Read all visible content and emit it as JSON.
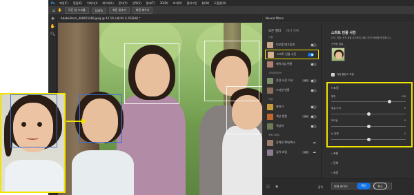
{
  "menubar": {
    "items": [
      "파일(F)",
      "편집(E)",
      "이미지(I)",
      "레이어(L)",
      "문자(Y)",
      "선택(S)",
      "필터(T)",
      "3D(D)",
      "보기(V)",
      "플러그인",
      "창(W)",
      "도움말(H)"
    ]
  },
  "share_label": "공유",
  "options": {
    "items": [
      "모든 창 스크롤",
      "100%",
      "화면 맞추기",
      "화면 채우기"
    ]
  },
  "document": {
    "tab_title": "AdobeStock_468625489.jpeg @ 42.5% (레이어 0, RGB/8) *"
  },
  "neural": {
    "panel_title": "Neural filters",
    "tab_all": "모든 필터",
    "tab_waitlist": "대기 목록",
    "cat_portrait": "인물",
    "cat_creative": "크리에이티브",
    "cat_color": "색상",
    "cat_photo": "포토그래피",
    "filters": [
      {
        "name": "피부를 매끄럽게",
        "state": "off"
      },
      {
        "name": "스마트 인물 사진",
        "state": "on"
      },
      {
        "name": "메이크업 변환",
        "state": "off"
      },
      {
        "name": "풍경 사진 믹서",
        "state": "off",
        "badge": "베타"
      },
      {
        "name": "스타일 변환",
        "state": "off"
      },
      {
        "name": "칠하기",
        "state": "off"
      },
      {
        "name": "색상 변환",
        "state": "off",
        "badge": "베타"
      },
      {
        "name": "색상화",
        "state": "off"
      },
      {
        "name": "강력한 확대/축소",
        "state": "download"
      },
      {
        "name": "깊이 흐림",
        "state": "download",
        "badge": "베타"
      }
    ],
    "settings": {
      "title": "스마트 인물 사진",
      "description": "나이, 표정, 포즈 등을 추가하여 인물 사진의 형태를 변경합니다.",
      "selected_face_label": "선택한 얼굴",
      "auto_color_label": "자동 밸런스 조정",
      "section_expression": "표정",
      "sliders": [
        {
          "label": "행복",
          "value": "+28",
          "position": 0.78
        },
        {
          "label": "얼굴 나이",
          "value": "0",
          "position": 0.5
        },
        {
          "label": "머리숱",
          "value": "0",
          "position": 0.5
        },
        {
          "label": "눈 방향",
          "value": "0",
          "position": 0.5
        }
      ],
      "section_face": "표현",
      "section_global": "전체",
      "section_settings": "설정"
    },
    "bottom": {
      "output_label": "출력",
      "output_value": "현재 레이어",
      "ok": "확인",
      "cancel": "취소"
    }
  }
}
